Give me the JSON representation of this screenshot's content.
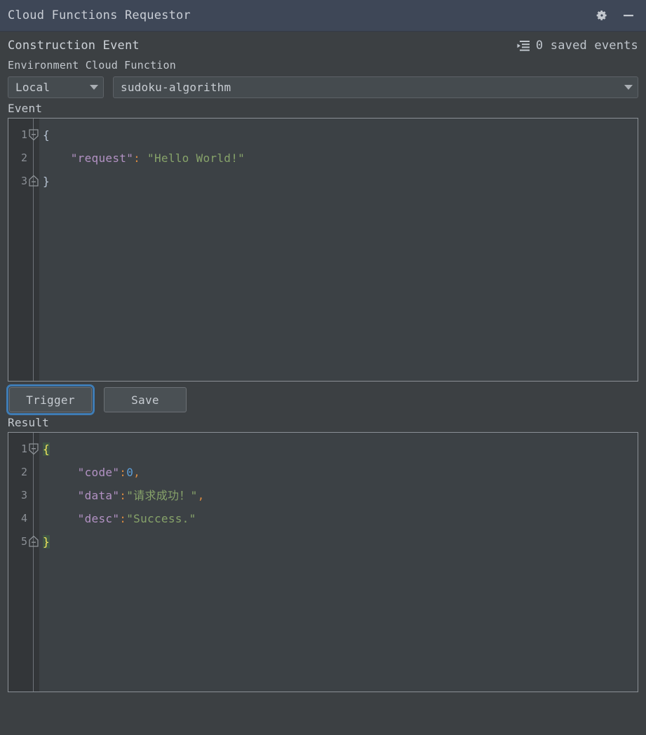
{
  "window": {
    "title": "Cloud Functions Requestor",
    "settings_icon": "gear-icon",
    "minimize_icon": "minimize-icon"
  },
  "header": {
    "section_title": "Construction Event",
    "saved_events_icon": "collapse-list-icon",
    "saved_events_label": "0 saved events",
    "saved_events_count": 0
  },
  "form": {
    "labels": "Environment Cloud Function",
    "environment": {
      "label": "Environment",
      "value": "Local",
      "caret_icon": "chevron-down-icon"
    },
    "cloud_function": {
      "label": "Cloud Function",
      "value": "sudoku-algorithm",
      "caret_icon": "chevron-down-icon"
    }
  },
  "event": {
    "label": "Event",
    "gutter": [
      {
        "number": "1",
        "fold": "open"
      },
      {
        "number": "2",
        "fold": "none"
      },
      {
        "number": "3",
        "fold": "close"
      }
    ],
    "lines": [
      {
        "n": "1",
        "tokens": [
          {
            "t": "punct",
            "v": "{"
          }
        ]
      },
      {
        "n": "2",
        "tokens": [
          {
            "t": "plain",
            "v": "    "
          },
          {
            "t": "key",
            "v": "\"request\""
          },
          {
            "t": "colon",
            "v": ":"
          },
          {
            "t": "plain",
            "v": " "
          },
          {
            "t": "str",
            "v": "\"Hello World!\""
          }
        ]
      },
      {
        "n": "3",
        "tokens": [
          {
            "t": "punct",
            "v": "}"
          }
        ]
      }
    ]
  },
  "actions": {
    "trigger_label": "Trigger",
    "save_label": "Save"
  },
  "result": {
    "label": "Result",
    "gutter": [
      {
        "number": "1",
        "fold": "open"
      },
      {
        "number": "2",
        "fold": "none"
      },
      {
        "number": "3",
        "fold": "none"
      },
      {
        "number": "4",
        "fold": "none"
      },
      {
        "number": "5",
        "fold": "close"
      }
    ],
    "lines": [
      {
        "n": "1",
        "tokens": [
          {
            "t": "brace-match",
            "v": "{"
          }
        ]
      },
      {
        "n": "2",
        "tokens": [
          {
            "t": "plain",
            "v": "     "
          },
          {
            "t": "key",
            "v": "\"code\""
          },
          {
            "t": "colon",
            "v": ":"
          },
          {
            "t": "num",
            "v": "0"
          },
          {
            "t": "comma",
            "v": ","
          }
        ]
      },
      {
        "n": "3",
        "tokens": [
          {
            "t": "plain",
            "v": "     "
          },
          {
            "t": "key",
            "v": "\"data\""
          },
          {
            "t": "colon",
            "v": ":"
          },
          {
            "t": "str",
            "v": "\"请求成功！\""
          },
          {
            "t": "comma",
            "v": ","
          }
        ]
      },
      {
        "n": "4",
        "tokens": [
          {
            "t": "plain",
            "v": "     "
          },
          {
            "t": "key",
            "v": "\"desc\""
          },
          {
            "t": "colon",
            "v": ":"
          },
          {
            "t": "str",
            "v": "\"Success.\""
          }
        ]
      },
      {
        "n": "5",
        "tokens": [
          {
            "t": "brace-match",
            "v": "}"
          }
        ]
      }
    ]
  },
  "colors": {
    "titlebar": "#3e4757",
    "background": "#3c4043",
    "editor_bg": "#3c4145",
    "gutter_bg": "#333639",
    "focus_ring": "#3f7cb5",
    "json_key": "#b392c4",
    "json_string": "#87a36a",
    "json_number": "#5d9dd6",
    "json_punct": "#d98a41",
    "brace_match_fg": "#f2e85c",
    "brace_match_bg": "#3f5646"
  }
}
